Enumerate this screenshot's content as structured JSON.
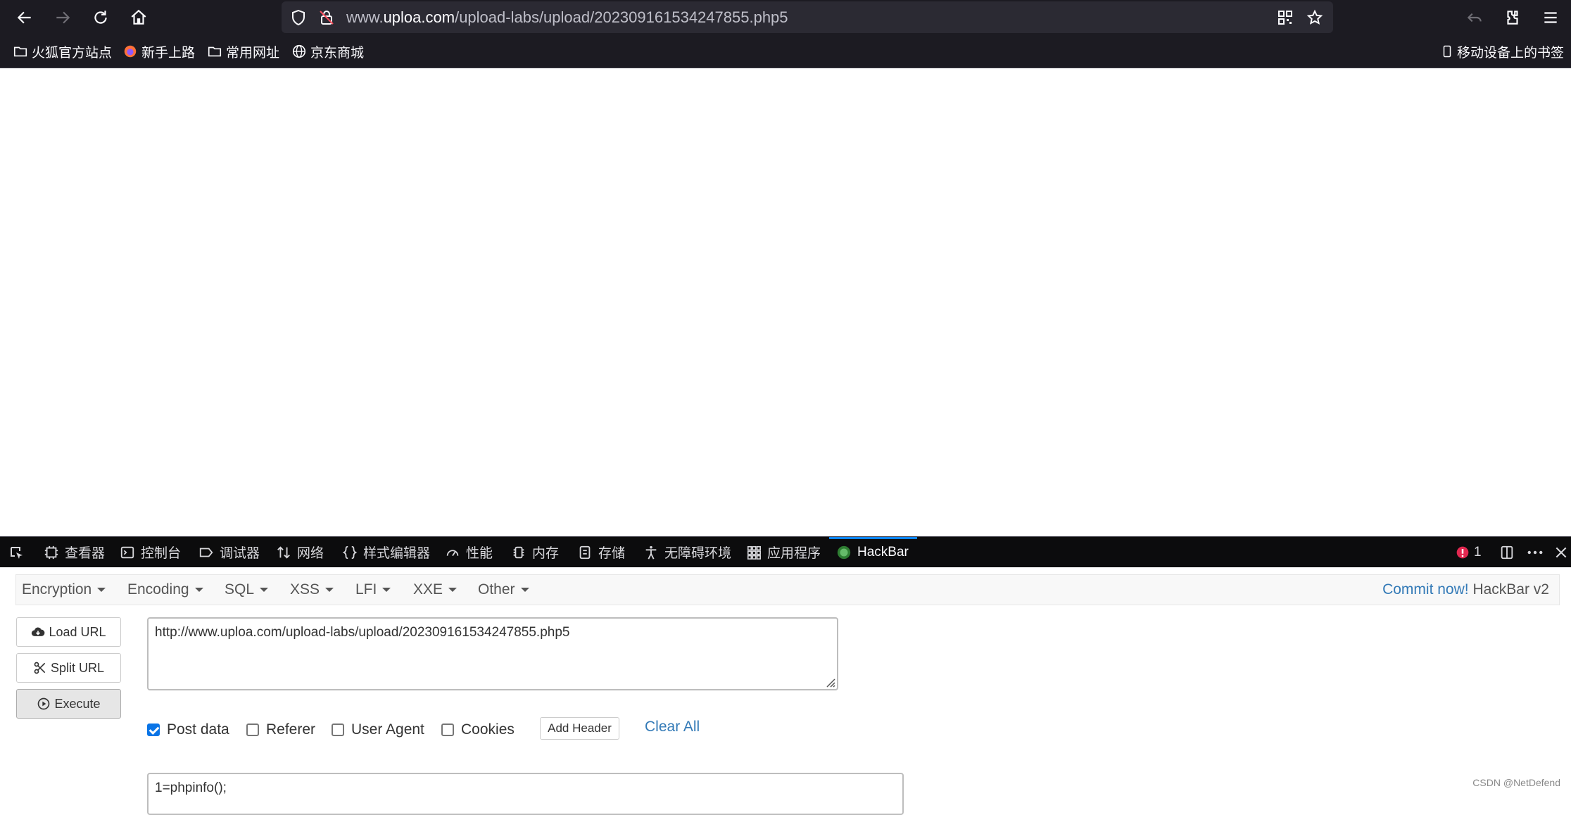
{
  "browser": {
    "url_host": "www.uploa.com",
    "url_path": "/upload-labs/upload/202309161534247855.php5",
    "url_prefix": "www.",
    "url_domain": "uploa.com"
  },
  "bookmarks": [
    {
      "label": "火狐官方站点",
      "icon": "folder-icon"
    },
    {
      "label": "新手上路",
      "icon": "firefox-icon"
    },
    {
      "label": "常用网址",
      "icon": "folder-icon"
    },
    {
      "label": "京东商城",
      "icon": "globe-icon"
    }
  ],
  "mobile_bookmarks": "移动设备上的书签",
  "devtools": {
    "tabs": [
      {
        "label": "查看器",
        "icon": "inspector-icon"
      },
      {
        "label": "控制台",
        "icon": "console-icon"
      },
      {
        "label": "调试器",
        "icon": "debugger-icon"
      },
      {
        "label": "网络",
        "icon": "network-icon"
      },
      {
        "label": "样式编辑器",
        "icon": "style-editor-icon"
      },
      {
        "label": "性能",
        "icon": "performance-icon"
      },
      {
        "label": "内存",
        "icon": "memory-icon"
      },
      {
        "label": "存储",
        "icon": "storage-icon"
      },
      {
        "label": "无障碍环境",
        "icon": "accessibility-icon"
      },
      {
        "label": "应用程序",
        "icon": "application-icon"
      },
      {
        "label": "HackBar",
        "icon": "hackbar-icon"
      }
    ],
    "error_count": "1"
  },
  "hackbar": {
    "menus": [
      "Encryption",
      "Encoding",
      "SQL",
      "XSS",
      "LFI",
      "XXE",
      "Other"
    ],
    "commit_link": "Commit now!",
    "version": "HackBar v2",
    "load_url": "Load URL",
    "split_url": "Split URL",
    "execute": "Execute",
    "url_value": "http://www.uploa.com/upload-labs/upload/202309161534247855.php5",
    "options": {
      "post_data": "Post data",
      "referer": "Referer",
      "user_agent": "User Agent",
      "cookies": "Cookies"
    },
    "add_header": "Add Header",
    "clear_all": "Clear All",
    "post_value": "1=phpinfo();"
  },
  "watermark": "CSDN @NetDefend"
}
